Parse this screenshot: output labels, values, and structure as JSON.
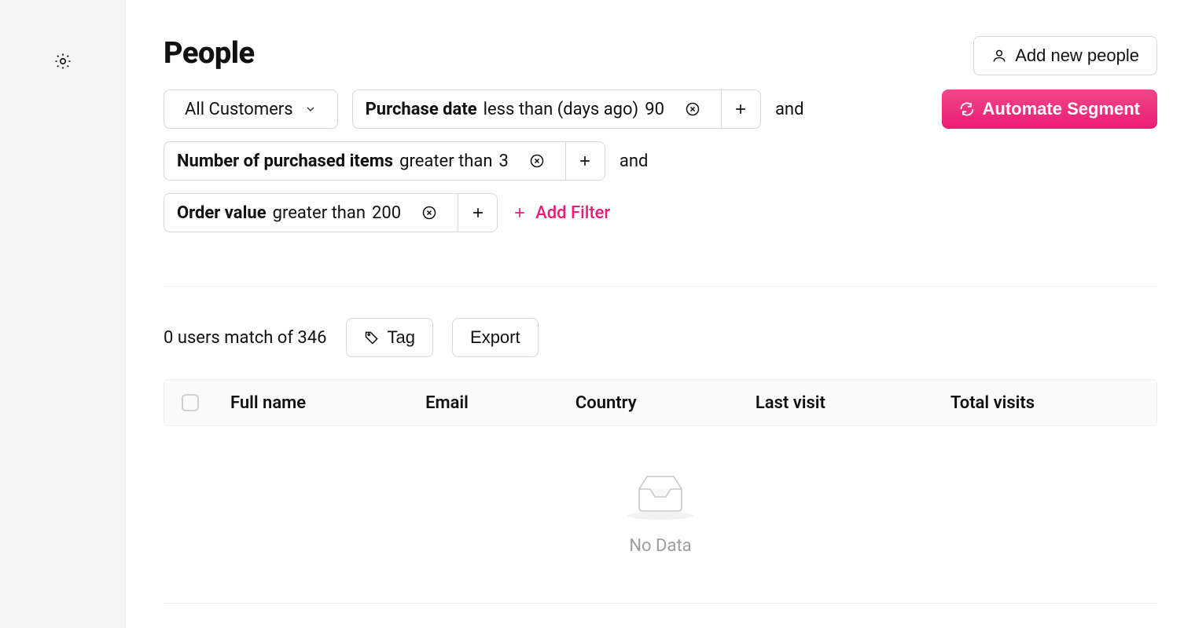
{
  "sidebar": {
    "settings_label": "Settings"
  },
  "header": {
    "title": "People",
    "add_button": "Add new people",
    "automate_button": "Automate Segment"
  },
  "segment_selector": {
    "selected": "All Customers"
  },
  "filters": [
    {
      "field": "Purchase date",
      "operator": "less than (days ago)",
      "value": "90",
      "conjunction": "and"
    },
    {
      "field": "Number of purchased items",
      "operator": "greater than",
      "value": "3",
      "conjunction": "and"
    },
    {
      "field": "Order value",
      "operator": "greater than",
      "value": "200",
      "conjunction": null
    }
  ],
  "add_filter_label": "Add Filter",
  "results": {
    "match_count": 0,
    "total_count": 346,
    "match_text": "0 users match of 346",
    "tag_button": "Tag",
    "export_button": "Export"
  },
  "table": {
    "columns": [
      "Full name",
      "Email",
      "Country",
      "Last visit",
      "Total visits"
    ]
  },
  "empty_state": {
    "label": "No Data"
  },
  "colors": {
    "accent": "#eb1c75",
    "border": "#d9d9d9",
    "muted": "#9e9e9e"
  }
}
